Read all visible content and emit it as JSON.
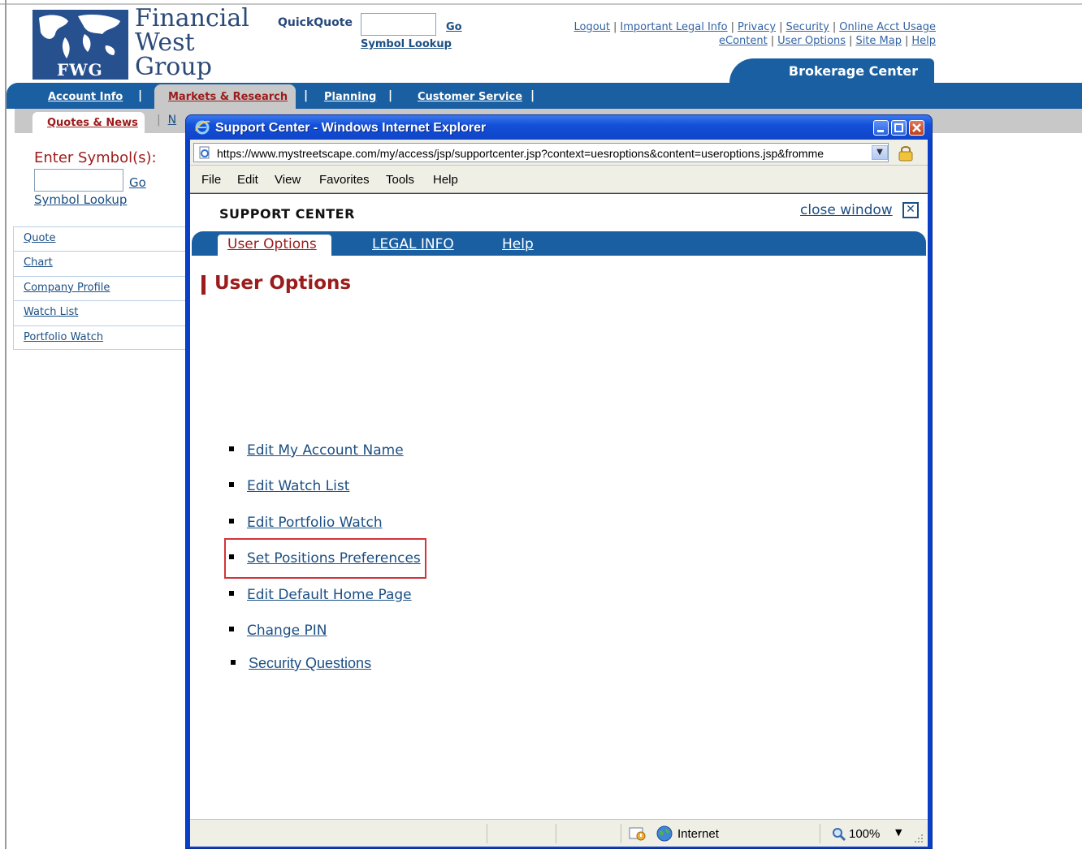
{
  "site": {
    "brand_line1": "Financial",
    "brand_line2": "West",
    "brand_line3": "Group",
    "logo_text": "FWG",
    "quickquote": {
      "label": "QuickQuote",
      "value": "",
      "go": "Go",
      "lookup": "Symbol Lookup"
    },
    "util_links": [
      "Logout",
      "Important Legal Info",
      "Privacy",
      "Security",
      "Online Acct Usage",
      "eContent",
      "User Options",
      "Site Map",
      "Help"
    ],
    "section_title": "Brokerage Center",
    "main_nav": [
      "Account Info",
      "Markets & Research",
      "Planning",
      "Customer Service"
    ],
    "active_main_nav": "Markets & Research",
    "sub_nav": {
      "active": "Quotes & News",
      "next_partial": "N"
    },
    "symbol_entry": {
      "label": "Enter Symbol(s):",
      "value": "",
      "go": "Go",
      "lookup": "Symbol Lookup"
    },
    "left_nav": [
      "Quote",
      "Chart",
      "Company Profile",
      "Watch List",
      "Portfolio Watch"
    ]
  },
  "popup": {
    "title": "Support Center - Windows Internet Explorer",
    "url": "https://www.mystreetscape.com/my/access/jsp/supportcenter.jsp?context=uesroptions&content=useroptions.jsp&fromme",
    "menu": [
      "File",
      "Edit",
      "View",
      "Favorites",
      "Tools",
      "Help"
    ],
    "header": "SUPPORT CENTER",
    "close_window": "close window",
    "tabs": [
      "User Options",
      "LEGAL INFO",
      "Help"
    ],
    "active_tab": "User Options",
    "heading": "User Options",
    "options": [
      "Edit My Account Name",
      "Edit Watch List",
      "Edit Portfolio Watch",
      "Set Positions Preferences",
      "Edit Default Home Page",
      "Change PIN"
    ],
    "highlighted_option": "Security Questions",
    "status": {
      "zone": "Internet",
      "zoom": "100%"
    }
  },
  "colors": {
    "brand_blue": "#1a5fa1",
    "logo_blue": "#27508f",
    "accent_red": "#9b1c1c",
    "link_blue": "#1c4f84",
    "xp_title_blue": "#0a3fc9",
    "highlight_red": "#d2343c"
  },
  "icons": [
    "ie-logo-icon",
    "minimize-icon",
    "maximize-icon",
    "close-icon",
    "page-icon",
    "dropdown-icon",
    "lock-icon",
    "protected-mode-icon",
    "globe-icon",
    "zoom-icon",
    "resize-grip-icon"
  ]
}
